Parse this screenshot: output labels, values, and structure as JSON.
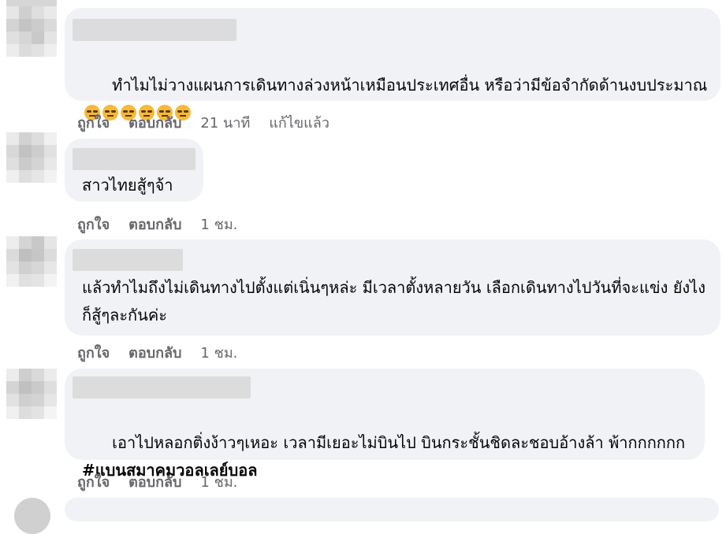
{
  "actions": {
    "like": "ถูกใจ",
    "reply": "ตอบกลับ"
  },
  "comments": [
    {
      "text": "ทำไมไม่วางแผนการเดินทางล่วงหน้าเหมือนประเทศอื่น หรือว่ามีข้อจำกัดด้านงบประมาณ",
      "emoji_icons": [
        "rolling-eyes-icon",
        "rolling-eyes-icon",
        "rolling-eyes-icon",
        "rolling-eyes-icon",
        "rolling-eyes-icon",
        "rolling-eyes-icon"
      ],
      "time": "21 นาที",
      "edited": "แก้ไขแล้ว"
    },
    {
      "text": "สาวไทยสู้ๆจ้า",
      "time": "1 ชม."
    },
    {
      "text": "แล้วทำไมถึงไม่เดินทางไปตั้งแต่เนิ่นๆหล่ะ มีเวลาตั้งหลายวัน เลือกเดินทางไปวันที่จะแข่ง ยังไงก็สู้ๆละกันค่ะ",
      "time": "1 ชม."
    },
    {
      "text": "เอาไปหลอกติ่งง้าวๆเหอะ เวลามีเยอะไม่บินไป บินกระชั้นชิดละชอบอ้างล้า พ้ากกกกกก",
      "hashtag": "#แบนสมาคมวอลเลย์บอล",
      "time": "1 ชม."
    }
  ]
}
